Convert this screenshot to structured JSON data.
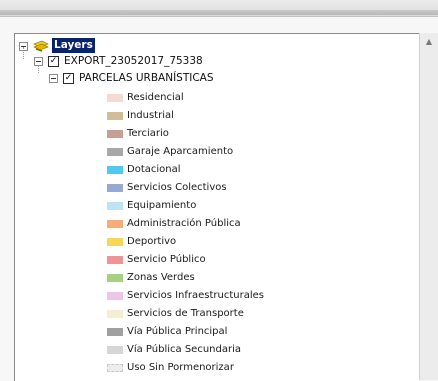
{
  "toc": {
    "root": {
      "label": "Layers"
    },
    "layer": {
      "name": "EXPORT_23052017_75338",
      "checked": true
    },
    "sublayer": {
      "name": "PARCELAS URBANÍSTICAS",
      "checked": true
    },
    "legend": [
      {
        "label": "Residencial",
        "color": "#f3dcd2"
      },
      {
        "label": "Industrial",
        "color": "#d2be96"
      },
      {
        "label": "Terciario",
        "color": "#c59e94"
      },
      {
        "label": "Garaje Aparcamiento",
        "color": "#a8a8a8"
      },
      {
        "label": "Dotacional",
        "color": "#50c8f0"
      },
      {
        "label": "Servicios Colectivos",
        "color": "#94aad4"
      },
      {
        "label": "Equipamiento",
        "color": "#bde3f5"
      },
      {
        "label": "Administración Pública",
        "color": "#f7ad78"
      },
      {
        "label": "Deportivo",
        "color": "#f8d658"
      },
      {
        "label": "Servicio Público",
        "color": "#ee9494"
      },
      {
        "label": "Zonas Verdes",
        "color": "#a5d27e"
      },
      {
        "label": "Servicios Infraestructurales",
        "color": "#eac7e6"
      },
      {
        "label": "Servicios de Transporte",
        "color": "#f6eed3"
      },
      {
        "label": "Vía Pública Principal",
        "color": "#a0a0a0"
      },
      {
        "label": "Vía Pública Secundaria",
        "color": "#d6d6d6"
      },
      {
        "label": "Uso Sin Pormenorizar",
        "color": "#ededed"
      }
    ]
  }
}
